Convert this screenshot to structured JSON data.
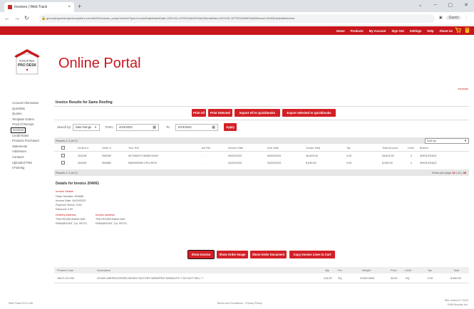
{
  "browser": {
    "tab_title": "Invoices | Web Track",
    "tab_close": "×",
    "new_tab": "+",
    "url": "gvmurphyportal.apicloranyhere.com/8443/invoices_caops?searchType=InvoiceDate&startDate=2023-04-10T00%3A00%3A00&endDate=2023-05-10T23%3A59%3A59&sord=204061#detailsAnchor",
    "guest_label": "Guest",
    "window_controls": [
      "⌄",
      "–",
      "▢",
      "✕"
    ]
  },
  "topnav": {
    "items": [
      "Home",
      "Products",
      "My Account",
      "Sign Out",
      "Settings",
      "Help",
      "About Us"
    ],
    "cart_color": "#f4c21a",
    "cart_icon": "cart-icon",
    "alert_icon": "cart-alert-icon"
  },
  "header": {
    "logo_line1": "ROOFING",
    "logo_line2": "PRO DESK",
    "title": "Online Portal",
    "breadcrumb": "Invoices"
  },
  "sidebar": {
    "items": [
      {
        "label": "Account Information"
      },
      {
        "label": "Quicklists"
      },
      {
        "label": "Quotes"
      },
      {
        "label": "Template Orders"
      },
      {
        "label": "Proof of Receipt"
      },
      {
        "label": "Invoices"
      },
      {
        "label": "Credit Notes"
      },
      {
        "label": "Products Purchased"
      },
      {
        "label": "Statements"
      },
      {
        "label": "Addresses"
      },
      {
        "label": "Contacts"
      },
      {
        "label": "Uploaded Files"
      },
      {
        "label": "eTraining"
      }
    ]
  },
  "main": {
    "title": "Invoice Results for Sams Roofing",
    "actions": [
      "Print All",
      "Print Selected",
      "Export All to Quickbooks",
      "Export Selected to Quickbooks"
    ],
    "search": {
      "search_by_label": "Search by:",
      "search_by_value": "Date Range",
      "from_label": "From:",
      "from_value": "4/10/2023",
      "to_label": "To:",
      "to_value": "5/10/2023",
      "apply": "Apply"
    },
    "pager_top": "Results 1-2 (of 2)",
    "sort_label": "Sort by",
    "columns": [
      "Invoice #",
      "Order #",
      "Your Ref",
      "Job Ref",
      "Invoice Date",
      "Due Date",
      "Goods Total",
      "Tax",
      "Total Amount",
      "Lines",
      "Branch"
    ],
    "rows": [
      [
        "204155",
        "906098",
        "9073460TS 56465 NHAT",
        "-",
        "05/02/2023",
        "05/03/2023",
        "28,603.00",
        "0.00",
        "28,603.00",
        "2",
        "WHOLESALE"
      ],
      [
        "204061",
        "900685",
        "5469939290 CPU 9876",
        "-",
        "04/20/2023",
        "04/20/2023",
        "8,930.00",
        "0.00",
        "8,930.00",
        "1",
        "WHOLESALE"
      ]
    ],
    "pager_bottom": "Results 1-2 (of 2)",
    "per_page_label": "Items per page",
    "per_page_options": [
      "12",
      "24",
      "48"
    ],
    "details": {
      "title": "Details for Invoice 204061",
      "section_label": "Invoice Details",
      "lines": [
        "Order Number:  900685",
        "Invoice Date:  04/20/2023",
        "Payment Terms: COD",
        "Discount:      0.00"
      ],
      "delivery_label": "Delivery Address",
      "delivery_lines": [
        "7940 ROSECRANS AVE",
        "PARAMOUNT, CA, 90723"
      ],
      "invoice_addr_label": "Invoice Address",
      "invoice_addr_lines": [
        "7940 ROSECRANS AVE",
        "PARAMOUNT, CA, 90723"
      ]
    },
    "detail_actions": [
      "Show Invoice",
      "Show Order Image",
      "Show Order Document",
      "Copy Invoice Lines to Cart"
    ],
    "line_columns": [
      "Product Code",
      "Description",
      "Qty",
      "Per",
      "Weight",
      "Price",
      "UOM",
      "Tax",
      "Total"
    ],
    "line_rows": [
      [
        "15471-F4-030",
        "ATLWH UNPROCESSED MIXED FACTORY WRAPPED SHINGLES ** DO NOT SELL **",
        "216.00",
        "SQ",
        "47000.0000",
        "33.00",
        "SQ",
        "0.00",
        "8,930.00"
      ]
    ]
  },
  "footer": {
    "left": "Web Track 22.5.148",
    "center": "Terms and Conditions · Privacy Policy",
    "right1": "Site content © 2023",
    "right2": "G&M Murphy Inc."
  }
}
